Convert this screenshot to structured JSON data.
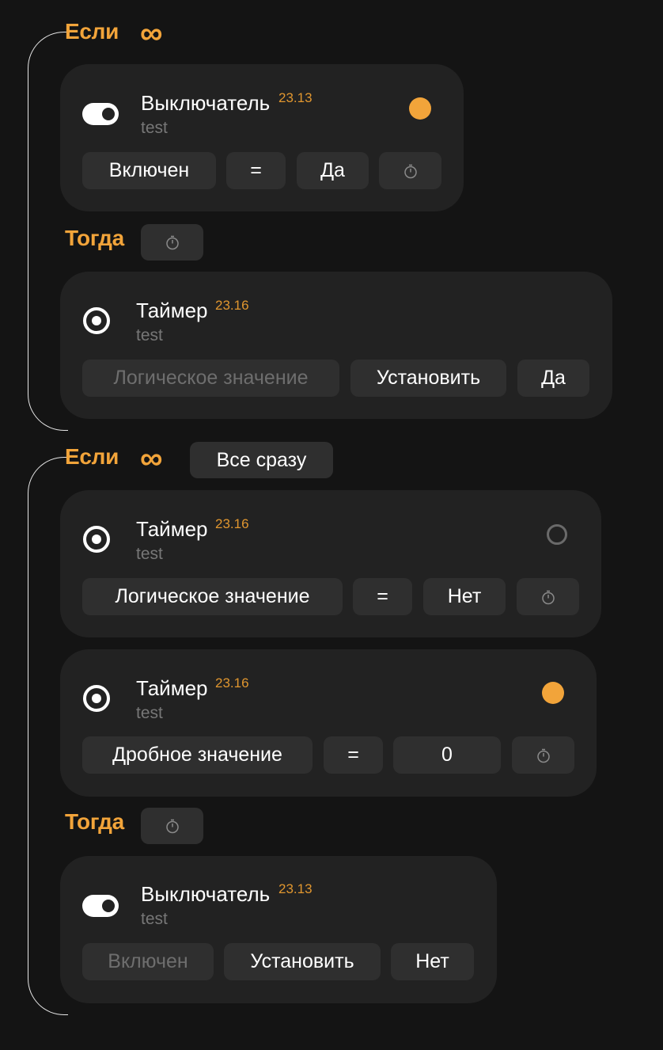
{
  "colors": {
    "accent": "#f2a43a",
    "background": "#141414",
    "card": "#222222",
    "chip": "#2f2f2f",
    "muted_text": "#777777"
  },
  "blocks": [
    {
      "if_label": "Если",
      "if_icon": "infinity-icon",
      "if_mode": "",
      "conditions": [
        {
          "device": "Выключатель",
          "version": "23.13",
          "subtitle": "test",
          "icon": "toggle-switch-icon",
          "status": "active",
          "property": "Включен",
          "operator": "=",
          "value": "Да",
          "timer_icon": "stopwatch-icon"
        }
      ],
      "then_label": "Тогда",
      "then_timer_icon": "stopwatch-icon",
      "actions": [
        {
          "device": "Таймер",
          "version": "23.16",
          "subtitle": "test",
          "icon": "radio-target-icon",
          "property": "Логическое значение",
          "action": "Установить",
          "value": "Да"
        }
      ]
    },
    {
      "if_label": "Если",
      "if_icon": "infinity-icon",
      "if_mode": "Все сразу",
      "conditions": [
        {
          "device": "Таймер",
          "version": "23.16",
          "subtitle": "test",
          "icon": "radio-target-icon",
          "status": "inactive",
          "property": "Логическое значение",
          "operator": "=",
          "value": "Нет",
          "timer_icon": "stopwatch-icon"
        },
        {
          "device": "Таймер",
          "version": "23.16",
          "subtitle": "test",
          "icon": "radio-target-icon",
          "status": "active",
          "property": "Дробное значение",
          "operator": "=",
          "value": "0",
          "timer_icon": "stopwatch-icon"
        }
      ],
      "then_label": "Тогда",
      "then_timer_icon": "stopwatch-icon",
      "actions": [
        {
          "device": "Выключатель",
          "version": "23.13",
          "subtitle": "test",
          "icon": "toggle-switch-icon",
          "property": "Включен",
          "action": "Установить",
          "value": "Нет"
        }
      ]
    }
  ]
}
